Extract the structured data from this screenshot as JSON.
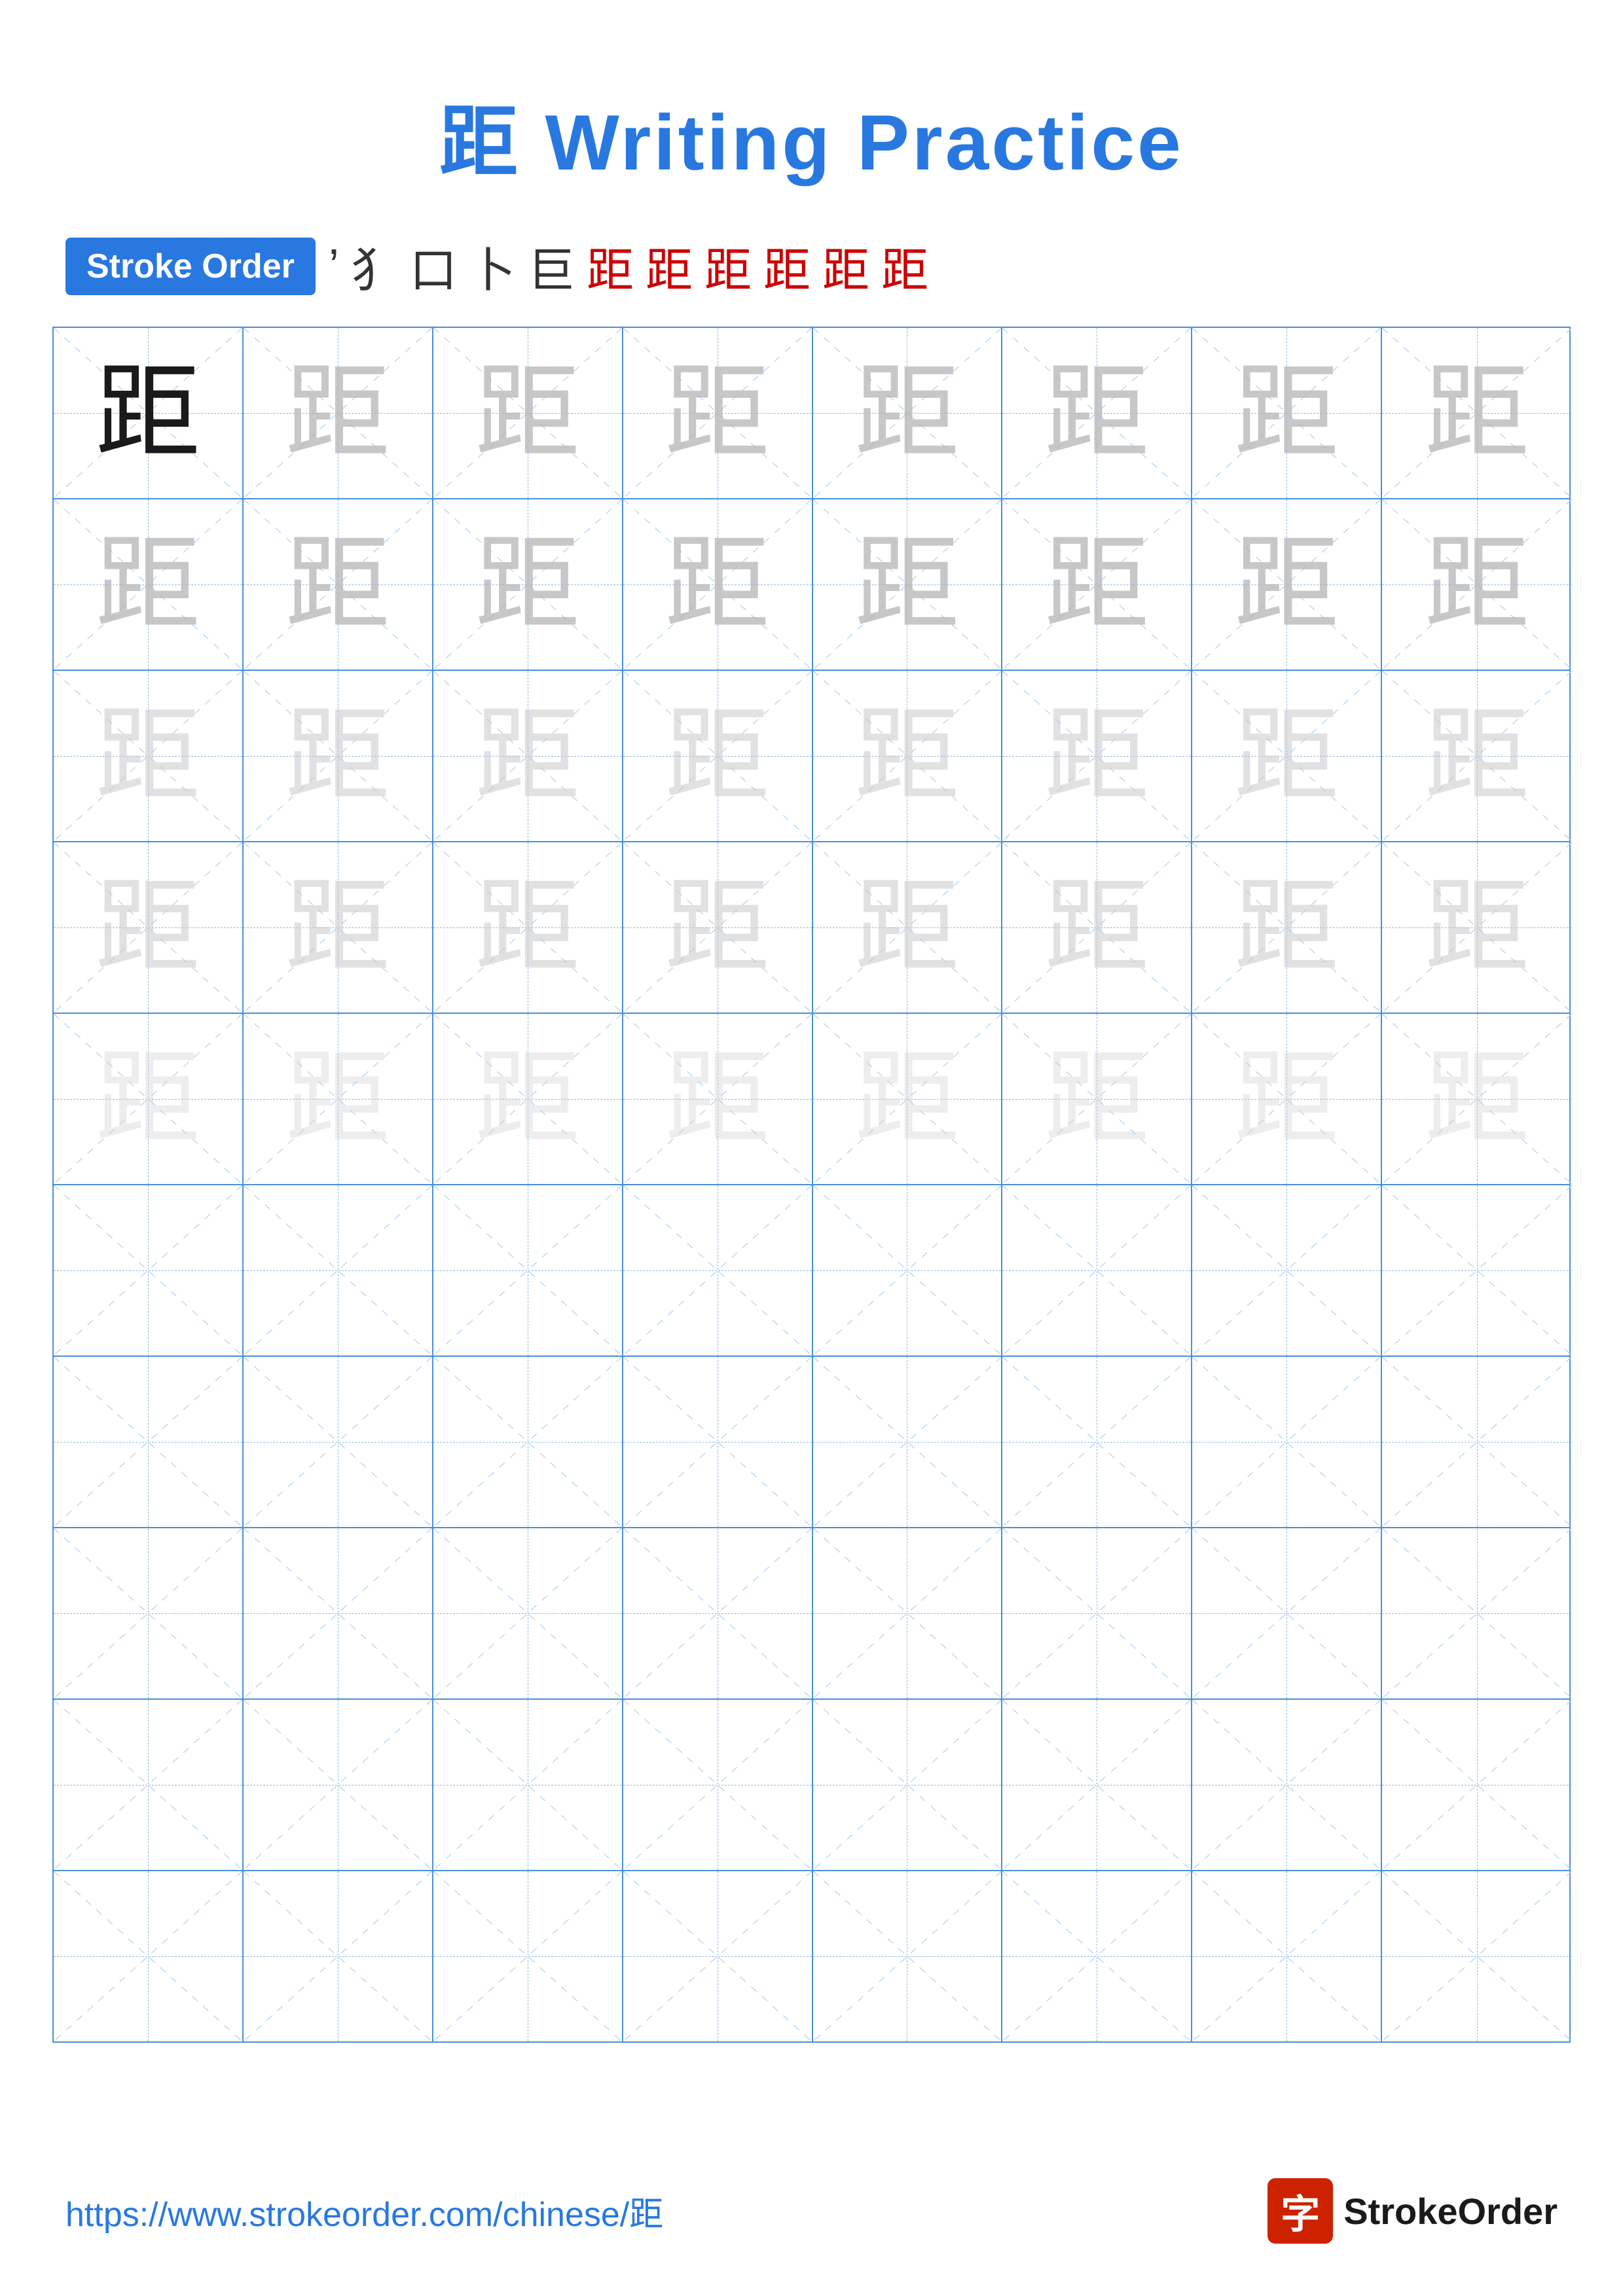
{
  "title": "距 Writing Practice",
  "stroke_order": {
    "badge_label": "Stroke Order",
    "strokes": [
      "㇐",
      "⺋",
      "口",
      "卜",
      "巨",
      "距",
      "距",
      "距",
      "距",
      "距",
      "距"
    ]
  },
  "character": "距",
  "grid": {
    "rows": 10,
    "cols": 8
  },
  "footer": {
    "url": "https://www.strokeorder.com/chinese/距",
    "logo_text": "StrokeOrder",
    "logo_icon": "字"
  }
}
